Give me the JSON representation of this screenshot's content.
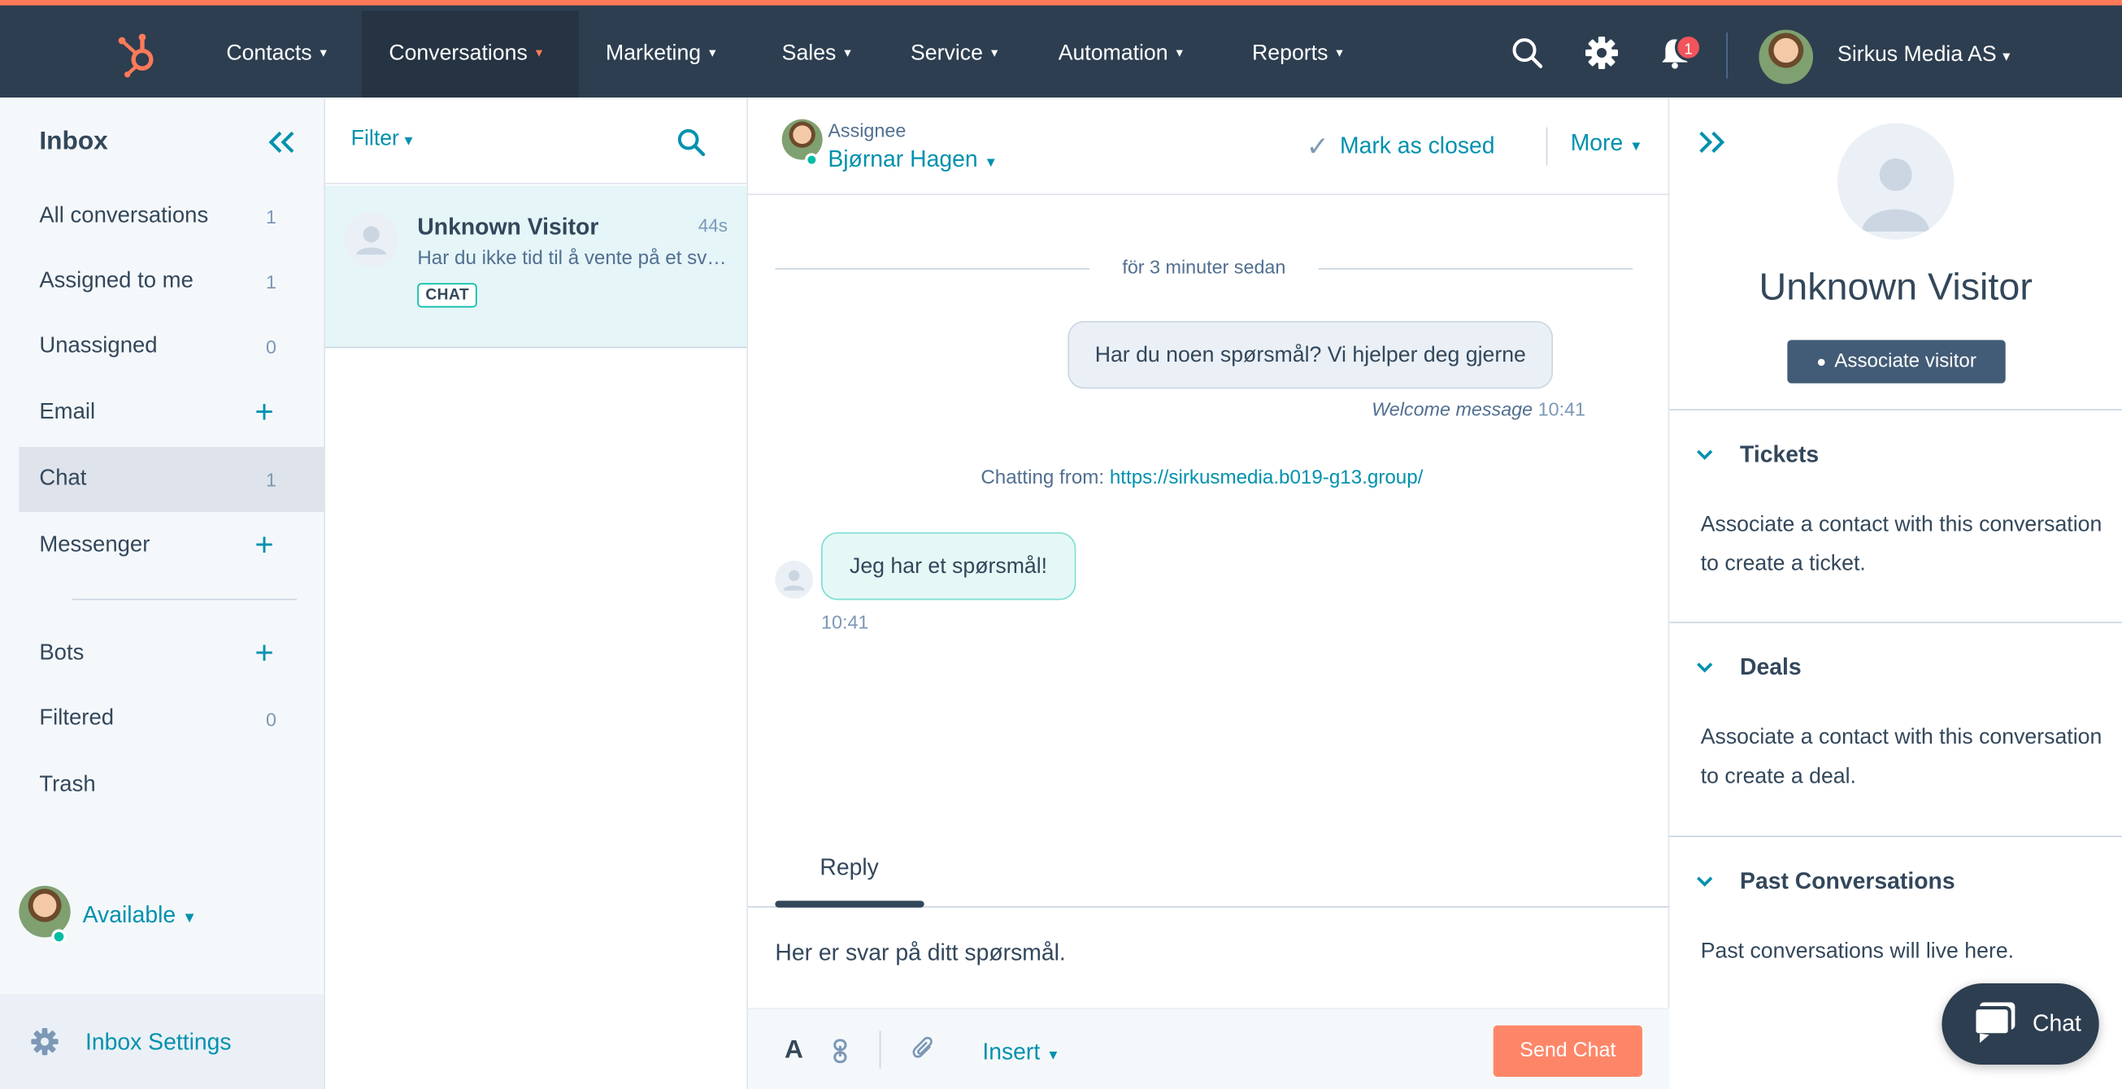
{
  "nav": {
    "items": [
      "Contacts",
      "Conversations",
      "Marketing",
      "Sales",
      "Service",
      "Automation",
      "Reports"
    ],
    "notification_count": "1",
    "account_name": "Sirkus Media AS",
    "caret": "⌄"
  },
  "sidebar": {
    "title": "Inbox",
    "items": [
      {
        "label": "All conversations",
        "count": "1"
      },
      {
        "label": "Assigned to me",
        "count": "1"
      },
      {
        "label": "Unassigned",
        "count": "0"
      },
      {
        "label": "Email",
        "count": "+"
      },
      {
        "label": "Chat",
        "count": "1"
      },
      {
        "label": "Messenger",
        "count": "+"
      },
      {
        "label": "Bots",
        "count": "+"
      },
      {
        "label": "Filtered",
        "count": "0"
      },
      {
        "label": "Trash",
        "count": ""
      }
    ],
    "status": "Available",
    "settings_label": "Inbox Settings"
  },
  "conversation_list": {
    "filter_label": "Filter",
    "card": {
      "name": "Unknown Visitor",
      "time": "44s",
      "preview": "Har du ikke tid til å vente på et svar? Legg igjen e-postadressen din",
      "tag": "CHAT"
    }
  },
  "thread": {
    "assignee_label": "Assignee",
    "assignee_name": "Bjørnar Hagen",
    "mark_closed": "Mark as closed",
    "more": "More",
    "time_divider": "för 3 minuter sedan",
    "welcome_message": "Har du noen spørsmål? Vi hjelper deg gjerne",
    "welcome_label": "Welcome message",
    "welcome_time": "10:41",
    "chatting_from_label": "Chatting from:",
    "chatting_from_url": "https://sirkusmedia.b019-g13.group/",
    "visitor_message": "Jeg har et spørsmål!",
    "visitor_time": "10:41",
    "reply_tab": "Reply",
    "composer_text": "Her er svar på ditt spørsmål.",
    "toolbar_A": "A",
    "insert_label": "Insert",
    "send_label": "Send Chat"
  },
  "right_panel": {
    "name": "Unknown Visitor",
    "associate_button": "Associate visitor",
    "sections": [
      {
        "title": "Tickets",
        "body": "Associate a contact with this conversation to create a ticket."
      },
      {
        "title": "Deals",
        "body": "Associate a contact with this conversation to create a deal."
      },
      {
        "title": "Past Conversations",
        "body": "Past conversations will live here."
      }
    ],
    "chat_launcher_label": "Chat"
  },
  "colors": {
    "nav_bg": "#2d3e50",
    "accent_orange": "#ff7a59",
    "link_teal": "#0091ae",
    "online_green": "#00bda5"
  },
  "icons": [
    "hubspot-logo-icon",
    "search-icon",
    "gear-icon",
    "bell-icon",
    "collapse-double-chevron-icon",
    "expand-double-chevron-icon",
    "checkmark-icon",
    "link-icon",
    "paperclip-icon",
    "chat-bubble-icon",
    "person-icon"
  ]
}
